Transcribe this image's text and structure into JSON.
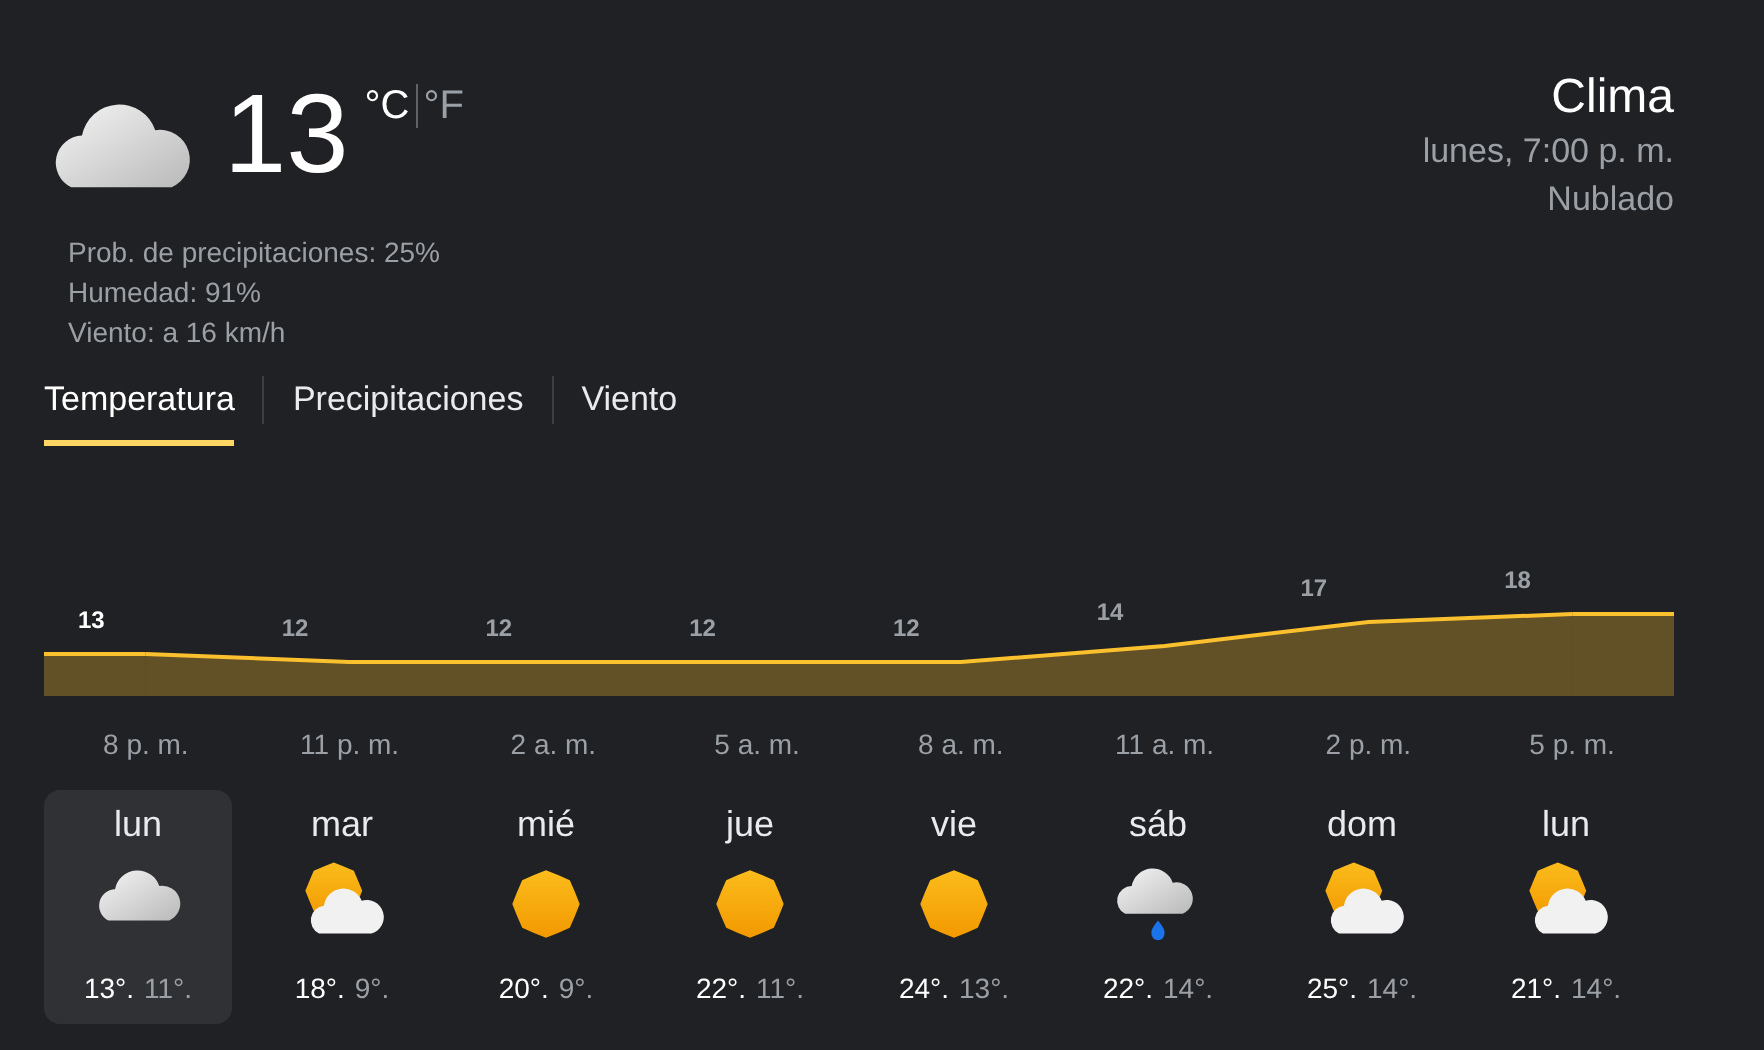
{
  "current": {
    "temperature": "13",
    "units": [
      {
        "label": "°C",
        "selected": true
      },
      {
        "label": "°F",
        "selected": false
      }
    ],
    "details": [
      "Prob. de precipitaciones: 25%",
      "Humedad: 91%",
      "Viento: a 16 km/h"
    ]
  },
  "header": {
    "title": "Clima",
    "datetime": "lunes, 7:00 p. m.",
    "condition": "Nublado"
  },
  "tabs": [
    {
      "label": "Temperatura",
      "selected": true
    },
    {
      "label": "Precipitaciones",
      "selected": false
    },
    {
      "label": "Viento",
      "selected": false
    }
  ],
  "chart": {
    "chart_data": {
      "type": "area",
      "categories": [
        "8 p. m.",
        "11 p. m.",
        "2 a. m.",
        "5 a. m.",
        "8 a. m.",
        "11 a. m.",
        "2 p. m.",
        "5 p. m."
      ],
      "series": [
        {
          "color": "#fbc02d",
          "values": [
            13,
            12,
            12,
            12,
            12,
            14,
            17,
            18
          ]
        }
      ],
      "data_labels": true
    }
  },
  "days": [
    {
      "day": "lun",
      "kind": "cloudy",
      "high": "13°.",
      "low": "11°.",
      "selected": true
    },
    {
      "day": "mar",
      "kind": "partly",
      "high": "18°.",
      "low": "9°.",
      "selected": false
    },
    {
      "day": "mié",
      "kind": "sunny",
      "high": "20°.",
      "low": "9°.",
      "selected": false
    },
    {
      "day": "jue",
      "kind": "sunny",
      "high": "22°.",
      "low": "11°.",
      "selected": false
    },
    {
      "day": "vie",
      "kind": "sunny",
      "high": "24°.",
      "low": "13°.",
      "selected": false
    },
    {
      "day": "sáb",
      "kind": "rain",
      "high": "22°.",
      "low": "14°.",
      "selected": false
    },
    {
      "day": "dom",
      "kind": "partly",
      "high": "25°.",
      "low": "14°.",
      "selected": false
    },
    {
      "day": "lun",
      "kind": "partly",
      "high": "21°.",
      "low": "14°.",
      "selected": false
    }
  ]
}
